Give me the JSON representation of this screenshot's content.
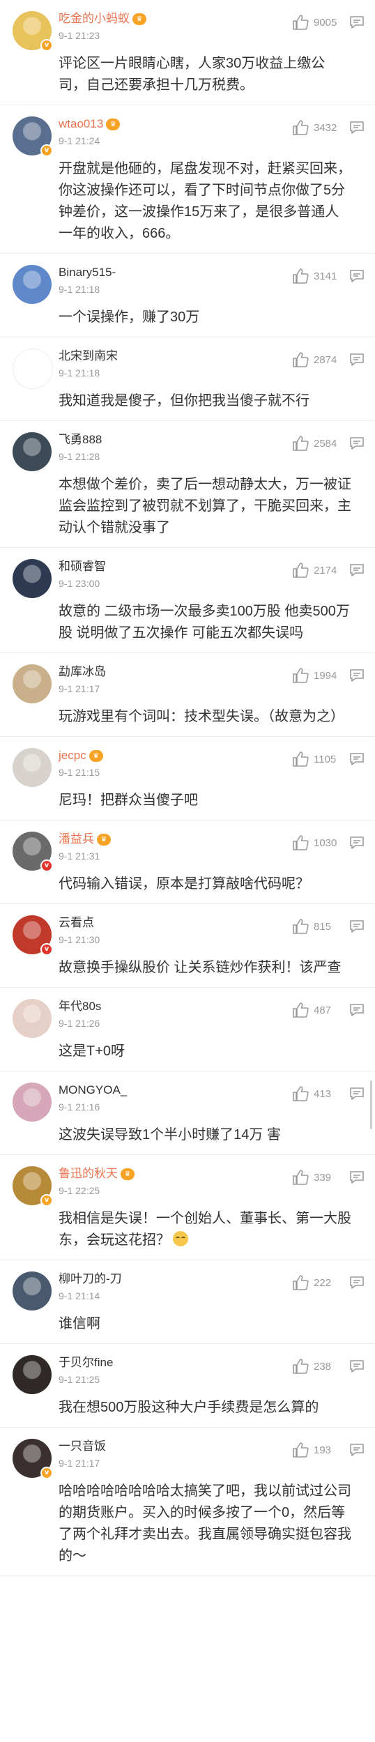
{
  "comments": [
    {
      "name": "吃金的小蚂蚁",
      "vip": true,
      "time": "9-1 21:23",
      "likes": "9005",
      "text": "评论区一片眼睛心瞎，人家30万收益上缴公司，自己还要承担十几万税费。",
      "avatar_color": "#e8c25a",
      "avatar_icon": "cartoon-avatar",
      "badge": "yellow"
    },
    {
      "name": "wtao013",
      "vip": true,
      "time": "9-1 21:24",
      "likes": "3432",
      "text": "开盘就是他砸的，尾盘发现不对，赶紧买回来，你这波操作还可以，看了下时间节点你做了5分钟差价，这一波操作15万来了，是很多普通人一年的收入，666。",
      "avatar_color": "#5a6f8f",
      "avatar_icon": "photo-avatar",
      "badge": "yellow"
    },
    {
      "name": "Binary515-",
      "vip": false,
      "time": "9-1 21:18",
      "likes": "3141",
      "text": "一个误操作，赚了30万",
      "avatar_color": "#5e88c9",
      "avatar_icon": "building-avatar",
      "badge": ""
    },
    {
      "name": "北宋到南宋",
      "vip": false,
      "time": "9-1 21:18",
      "likes": "2874",
      "text": "我知道我是傻子，但你把我当傻子就不行",
      "avatar_color": "#ffffff",
      "avatar_icon": "calligraphy-avatar",
      "badge": ""
    },
    {
      "name": "飞勇888",
      "vip": false,
      "time": "9-1 21:28",
      "likes": "2584",
      "text": "本想做个差价，卖了后一想动静太大，万一被证监会监控到了被罚就不划算了，干脆买回来，主动认个错就没事了",
      "avatar_color": "#3d4a57",
      "avatar_icon": "photo-avatar",
      "badge": ""
    },
    {
      "name": "和硕睿智",
      "vip": false,
      "time": "9-1 23:00",
      "likes": "2174",
      "text": "故意的 二级市场一次最多卖100万股 他卖500万股 说明做了五次操作 可能五次都失误吗",
      "avatar_color": "#2d3a52",
      "avatar_icon": "landscape-avatar",
      "badge": ""
    },
    {
      "name": "勐库冰岛",
      "vip": false,
      "time": "9-1 21:17",
      "likes": "1994",
      "text": "玩游戏里有个词叫：技术型失误。（故意为之）",
      "avatar_color": "#c9b08a",
      "avatar_icon": "person-avatar",
      "badge": ""
    },
    {
      "name": "jecpc",
      "vip": true,
      "time": "9-1 21:15",
      "likes": "1105",
      "text": "尼玛！把群众当傻子吧",
      "avatar_color": "#d8d2cc",
      "avatar_icon": "person-avatar",
      "badge": ""
    },
    {
      "name": "潘益兵",
      "vip": true,
      "time": "9-1 21:31",
      "likes": "1030",
      "text": "代码输入错误，原本是打算敲啥代码呢？",
      "avatar_color": "#6a6a6a",
      "avatar_icon": "person-avatar",
      "badge": "red"
    },
    {
      "name": "云看点",
      "vip": false,
      "time": "9-1 21:30",
      "likes": "815",
      "text": "故意换手操纵股价 让关系链炒作获利！该严查",
      "avatar_color": "#c0392b",
      "avatar_icon": "logo-avatar",
      "badge": "red"
    },
    {
      "name": "年代80s",
      "vip": false,
      "time": "9-1 21:26",
      "likes": "487",
      "text": "这是T+0呀",
      "avatar_color": "#e6cfc6",
      "avatar_icon": "person-avatar",
      "badge": ""
    },
    {
      "name": "MONGYOA_",
      "vip": false,
      "time": "9-1 21:16",
      "likes": "413",
      "text": "这波失误导致1个半小时赚了14万 害",
      "avatar_color": "#d6a7b8",
      "avatar_icon": "person-avatar",
      "badge": ""
    },
    {
      "name": "鲁迅的秋天",
      "vip": true,
      "time": "9-1 22:25",
      "likes": "339",
      "text": "我相信是失误！一个创始人、董事长、第一大股东，会玩这花招？",
      "emoji": true,
      "avatar_color": "#b78a3a",
      "avatar_icon": "landscape-avatar",
      "badge": "yellow"
    },
    {
      "name": "柳叶刀的-刀",
      "vip": false,
      "time": "9-1 21:14",
      "likes": "222",
      "text": "谁信啊",
      "avatar_color": "#4a5a6e",
      "avatar_icon": "landscape-avatar",
      "badge": ""
    },
    {
      "name": "于贝尔fine",
      "vip": false,
      "time": "9-1 21:25",
      "likes": "238",
      "text": "我在想500万股这种大户手续费是怎么算的",
      "avatar_color": "#2f2a28",
      "avatar_icon": "photo-avatar",
      "badge": ""
    },
    {
      "name": "一只音饭",
      "vip": false,
      "time": "9-1 21:17",
      "likes": "193",
      "text": "哈哈哈哈哈哈哈哈太搞笑了吧，我以前试过公司的期货账户。买入的时候多按了一个0，然后等了两个礼拜才卖出去。我直属领导确实挺包容我的～",
      "avatar_color": "#3a3030",
      "avatar_icon": "person-avatar",
      "badge": "yellow"
    }
  ]
}
